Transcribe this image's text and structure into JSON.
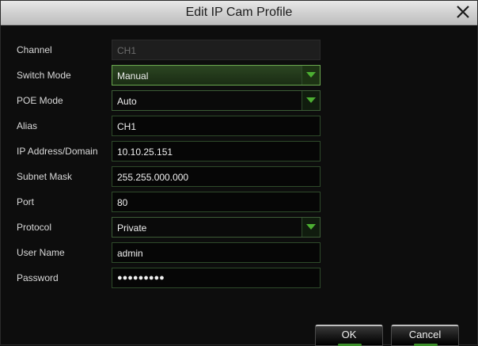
{
  "dialog": {
    "title": "Edit IP Cam Profile"
  },
  "fields": {
    "channel": {
      "label": "Channel",
      "value": "CH1"
    },
    "switch_mode": {
      "label": "Switch Mode",
      "value": "Manual"
    },
    "poe_mode": {
      "label": "POE Mode",
      "value": "Auto"
    },
    "alias": {
      "label": "Alias",
      "value": "CH1"
    },
    "ip": {
      "label": "IP Address/Domain",
      "value": "10.10.25.151"
    },
    "subnet": {
      "label": "Subnet Mask",
      "value": "255.255.000.000"
    },
    "port": {
      "label": "Port",
      "value": "80"
    },
    "protocol": {
      "label": "Protocol",
      "value": "Private"
    },
    "username": {
      "label": "User Name",
      "value": "admin"
    },
    "password": {
      "label": "Password",
      "value": "●●●●●●●●●"
    }
  },
  "buttons": {
    "ok": "OK",
    "cancel": "Cancel"
  },
  "colors": {
    "accent": "#4caf32",
    "titlebar": "#d4d4d4",
    "background": "#0d0d0d"
  },
  "icons": {
    "close": "close-icon",
    "dropdown": "chevron-down-icon"
  }
}
